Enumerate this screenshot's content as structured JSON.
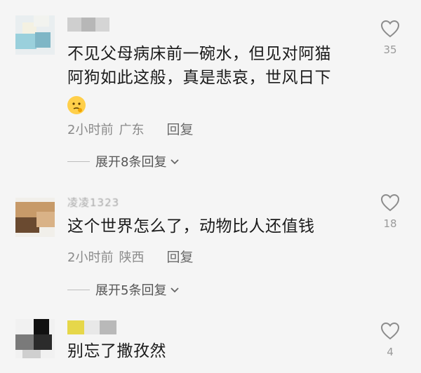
{
  "comments": [
    {
      "text_line1": "不见父母病床前一碗水，但见对阿猫",
      "text_line2": "阿狗如此这般，真是悲哀，世风日下",
      "emoji": "thinking-face-emoji",
      "time": "2小时前",
      "location": "广东",
      "reply_label": "回复",
      "likes": "35",
      "expand_label": "展开8条回复"
    },
    {
      "username_partial": "凌凌1323",
      "text_line1": "这个世界怎么了，动物比人还值钱",
      "time": "2小时前",
      "location": "陕西",
      "reply_label": "回复",
      "likes": "18",
      "expand_label": "展开5条回复"
    },
    {
      "text_line1": "别忘了撒孜然",
      "likes": "4"
    }
  ],
  "icons": {
    "like": "heart-outline-icon",
    "expand": "chevron-down-icon"
  }
}
